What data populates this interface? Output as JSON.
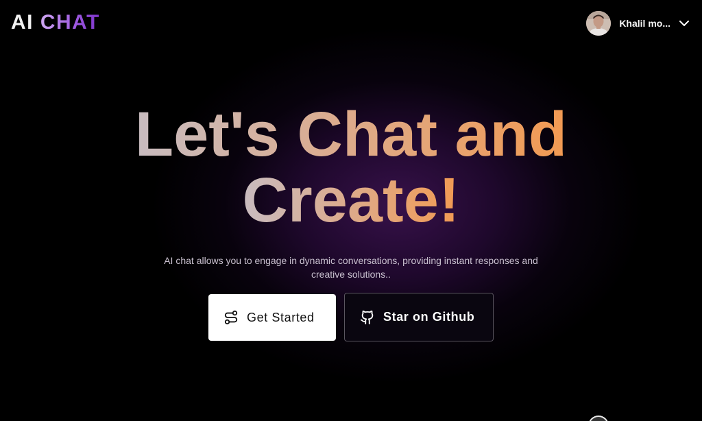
{
  "header": {
    "logo_ai": "AI",
    "logo_chat": "CHAT",
    "user_name": "Khalil mo...",
    "avatar_icon": "user-avatar",
    "menu_icon": "chevron-down-icon"
  },
  "hero": {
    "title_line1": "Let's Chat and",
    "title_line2": "Create!",
    "subtitle_line1": "AI chat allows you to engage in dynamic conversations, providing instant responses and",
    "subtitle_line2": "creative solutions.."
  },
  "actions": {
    "get_started": {
      "label": "Get Started",
      "icon": "route-icon"
    },
    "github": {
      "label": "Star on Github",
      "icon": "github-icon"
    }
  },
  "colors": {
    "background": "#000000",
    "glow": "#3a124e",
    "logo_chat_gradient": [
      "#cfa8f2",
      "#7c33c9"
    ],
    "title_gradient": [
      "#c8bcc0",
      "#f29a52"
    ],
    "primary_button": "#ffffff",
    "secondary_button_border": "#5b5660"
  }
}
